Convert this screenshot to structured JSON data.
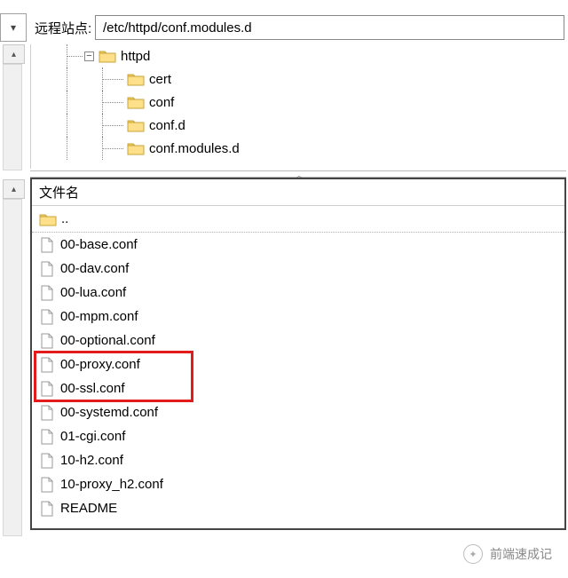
{
  "address": {
    "label": "远程站点:",
    "path": "/etc/httpd/conf.modules.d"
  },
  "tree": {
    "root": {
      "name": "httpd",
      "expanded": true
    },
    "children": [
      {
        "name": "cert"
      },
      {
        "name": "conf"
      },
      {
        "name": "conf.d"
      },
      {
        "name": "conf.modules.d"
      }
    ]
  },
  "list": {
    "header": "文件名",
    "parent": "..",
    "files": [
      {
        "name": "00-base.conf",
        "hl": false
      },
      {
        "name": "00-dav.conf",
        "hl": false
      },
      {
        "name": "00-lua.conf",
        "hl": false
      },
      {
        "name": "00-mpm.conf",
        "hl": false
      },
      {
        "name": "00-optional.conf",
        "hl": false
      },
      {
        "name": "00-proxy.conf",
        "hl": true
      },
      {
        "name": "00-ssl.conf",
        "hl": true
      },
      {
        "name": "00-systemd.conf",
        "hl": false
      },
      {
        "name": "01-cgi.conf",
        "hl": false
      },
      {
        "name": "10-h2.conf",
        "hl": false
      },
      {
        "name": "10-proxy_h2.conf",
        "hl": false
      },
      {
        "name": "README",
        "hl": false
      }
    ]
  },
  "watermark": "前端速成记"
}
